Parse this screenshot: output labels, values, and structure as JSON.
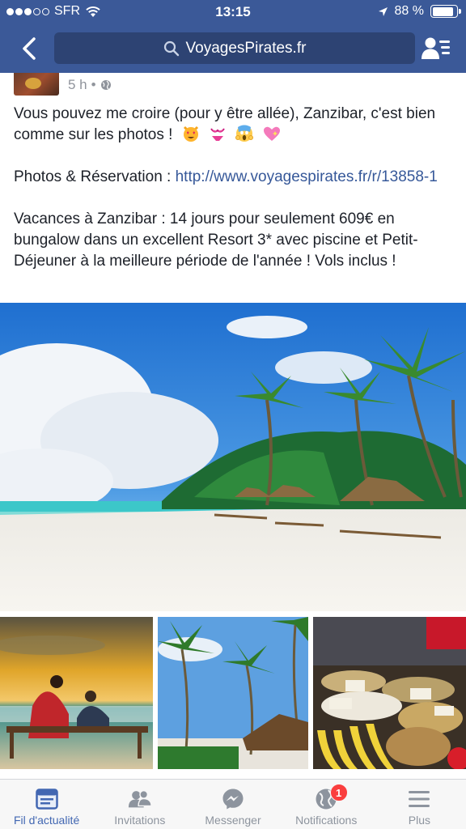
{
  "status_bar": {
    "carrier": "SFR",
    "time": "13:15",
    "battery": "88 %",
    "battery_level": 0.88,
    "icons": [
      "signal-dots-icon",
      "wifi-icon",
      "location-arrow-icon",
      "battery-icon"
    ]
  },
  "nav": {
    "search_text": "VoyagesPirates.fr",
    "back_icon": "chevron-left-icon",
    "search_icon": "search-icon",
    "friends_icon": "friend-requests-icon"
  },
  "post": {
    "time": "5 h",
    "separator": "•",
    "privacy_icon": "globe-icon",
    "line1": "Vous pouvez me croire (pour y être allée), Zanzibar, c'est bien comme sur les photos !",
    "emojis": [
      "heart-eyes-cat-emoji",
      "bikini-emoji",
      "scream-emoji",
      "sparkling-heart-emoji"
    ],
    "line2_label": "Photos & Réservation : ",
    "link": "http://www.voyagespirates.fr/r/13858-1",
    "line3": "Vacances à Zanzibar : 14 jours pour seulement 609€ en bungalow dans un excellent Resort 3* avec piscine et Petit-Déjeuner à la meilleure période de l'année ! Vols inclus !"
  },
  "tabs": [
    {
      "label": "Fil d'actualité",
      "icon": "news-feed-icon",
      "active": true
    },
    {
      "label": "Invitations",
      "icon": "friends-icon",
      "active": false
    },
    {
      "label": "Messenger",
      "icon": "messenger-icon",
      "active": false
    },
    {
      "label": "Notifications",
      "icon": "globe-notifications-icon",
      "active": false,
      "badge": "1"
    },
    {
      "label": "Plus",
      "icon": "menu-icon",
      "active": false
    }
  ],
  "colors": {
    "header": "#3b5998",
    "search_bg": "#2d4373",
    "link": "#365899",
    "active_tab": "#4267b2",
    "badge": "#fa3e3e"
  }
}
